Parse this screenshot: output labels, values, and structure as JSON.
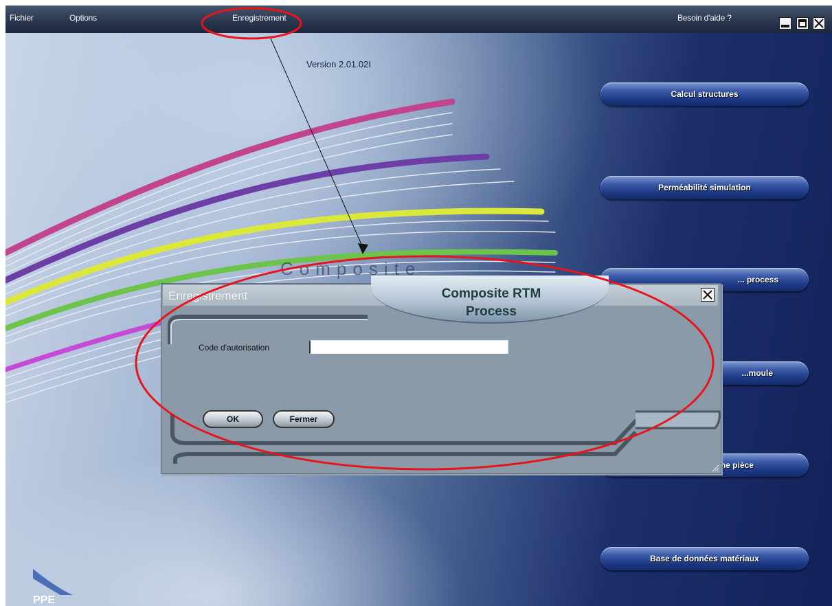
{
  "menu": {
    "fichier": "Fichier",
    "options": "Options",
    "enregistrement": "Enregistrement",
    "help": "Besoin d'aide ?"
  },
  "version": "Version 2.01.02I",
  "side_buttons": [
    {
      "label": "Calcul structures"
    },
    {
      "label": "Perméabilité simulation"
    },
    {
      "label": "... process"
    },
    {
      "label": "...moule"
    },
    {
      "label": "Coûts d'une pièce"
    },
    {
      "label": "Base de données matériaux"
    }
  ],
  "watermark": "Composite",
  "logo": "PPE",
  "dialog": {
    "title": "Enregistrement",
    "logo_line1": "Composite RTM",
    "logo_line2": "Process",
    "code_label": "Code d'autorisation",
    "code_value": "",
    "ok": "OK",
    "fermer": "Fermer"
  },
  "colors": {
    "annotation": "#e8141b",
    "button_blue": "#1d3a86"
  },
  "icons": {
    "minimize": "minimize-icon",
    "maximize": "maximize-icon",
    "close": "close-icon"
  }
}
